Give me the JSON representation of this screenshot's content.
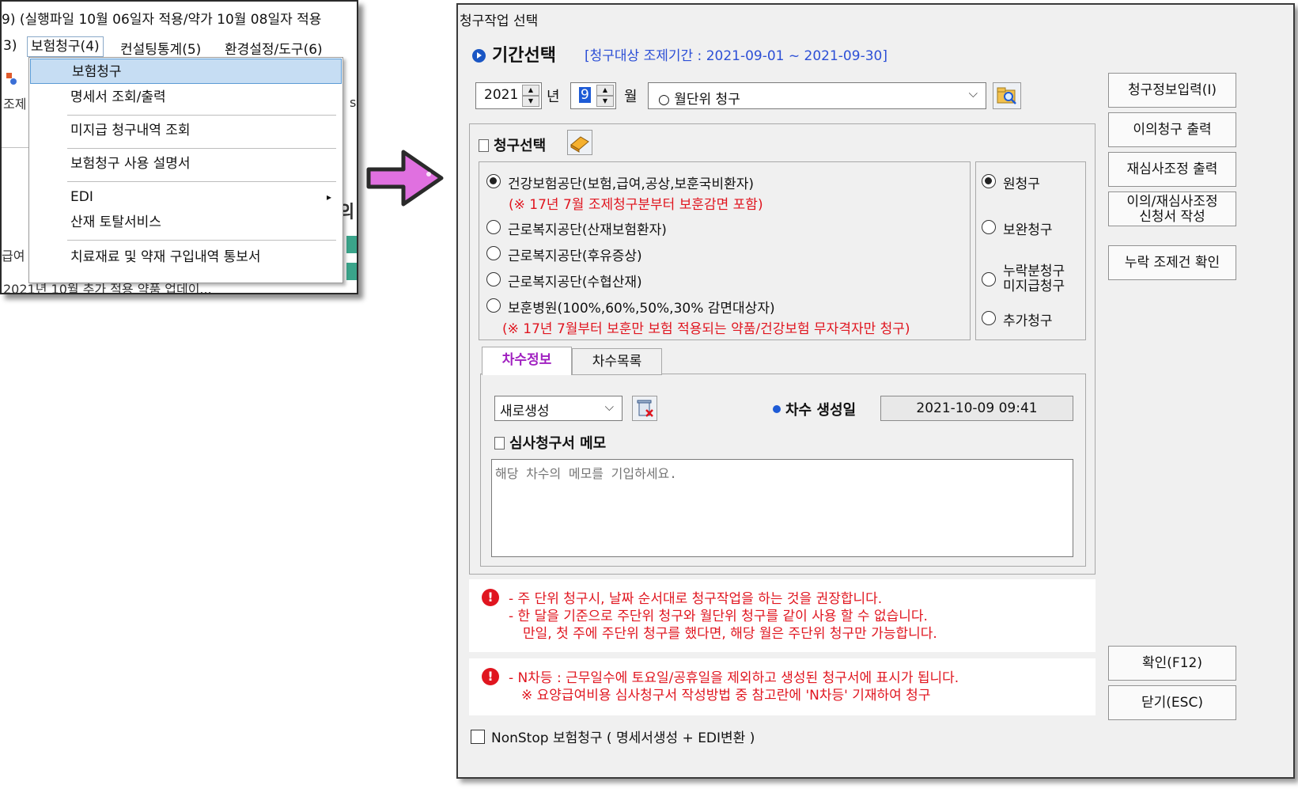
{
  "menu_screenshot": {
    "title_fragment": "9) (실행파일 10월 06일자 적용/약가 10월 08일자 적용",
    "menubar": [
      "3)",
      "보험청구(4)",
      "컨설팅통계(5)",
      "환경설정/도구(6)"
    ],
    "bg_fragments": {
      "left_label": "조제",
      "left_label2": "급여",
      "right_char": "의",
      "right_char2": "s",
      "bottom_text": "2021년 10월 추가 적용 약품 업데이..."
    },
    "dropdown_items": [
      {
        "label": "보험청구",
        "highlighted": true
      },
      {
        "label": "명세서 조회/출력"
      },
      {
        "label": "미지급 청구내역 조회"
      },
      {
        "label": "보험청구 사용 설명서"
      },
      {
        "label": "EDI",
        "has_submenu": true
      },
      {
        "label": "산재 토탈서비스"
      },
      {
        "label": "치료재료 및 약재 구입내역 통보서"
      }
    ],
    "submenu_arrow": "▸"
  },
  "arrow_color": "#e070e0",
  "dialog": {
    "title": "청구작업 선택",
    "period_heading": "기간선택",
    "period_range": "[청구대상 조제기간 : 2021-09-01 ~ 2021-09-30]",
    "year_value": "2021",
    "year_label": "년",
    "month_value": "9",
    "month_label": "월",
    "claim_unit": "○ 월단위 청구",
    "claim_select": {
      "heading": "청구선택",
      "options": [
        {
          "label": "건강보험공단(보험,급여,공상,보훈국비환자)",
          "selected": true,
          "note": "(※ 17년 7월 조제청구분부터 보훈감면 포함)"
        },
        {
          "label": "근로복지공단(산재보험환자)",
          "selected": false
        },
        {
          "label": "근로복지공단(후유증상)",
          "selected": false
        },
        {
          "label": "근로복지공단(수협산재)",
          "selected": false
        },
        {
          "label": "보훈병원(100%,60%,50%,30% 감면대상자)",
          "selected": false,
          "note": "(※ 17년 7월부터 보훈만 보험 적용되는 약품/건강보험 무자격자만 청구)"
        }
      ]
    },
    "claim_type": [
      {
        "label": "원청구",
        "selected": true
      },
      {
        "label": "보완청구",
        "selected": false
      },
      {
        "label_line1": "누락분청구",
        "label_line2": "미지급청구",
        "selected": false
      },
      {
        "label": "추가청구",
        "selected": false
      }
    ],
    "tabs": [
      "차수정보",
      "차수목록"
    ],
    "batch_combo": "새로생성",
    "batch_created_label": "차수 생성일",
    "batch_created_value": "2021-10-09 09:41",
    "memo_heading": "심사청구서 메모",
    "memo_placeholder": "해당 차수의 메모를 기입하세요.",
    "notes1": [
      "- 주 단위 청구시, 날짜 순서대로 청구작업을 하는 것을 권장합니다.",
      "- 한 달을 기준으로 주단위 청구와 월단위 청구를 같이 사용 할 수 없습니다.",
      "만일, 첫 주에 주단위 청구를 했다면, 해당 월은 주단위 청구만 가능합니다."
    ],
    "notes2": [
      "- N차등 : 근무일수에 토요일/공휴일을 제외하고 생성된 청구서에 표시가 됩니다.",
      "※ 요양급여비용 심사청구서 작성방법 중 참고란에 'N차등' 기재하여 청구"
    ],
    "warn_icon": "!",
    "nonstop_label": "NonStop 보험청구 ( 명세서생성 + EDI변환 )",
    "side_buttons": [
      {
        "label": "청구정보입력(I)"
      },
      {
        "label": "이의청구 출력"
      },
      {
        "label": "재심사조정 출력"
      },
      {
        "label_line1": "이의/재심사조정",
        "label_line2": "신청서 작성"
      },
      {
        "label": "누락 조제건 확인"
      }
    ],
    "confirm_button": "확인(F12)",
    "close_button": "닫기(ESC)"
  }
}
